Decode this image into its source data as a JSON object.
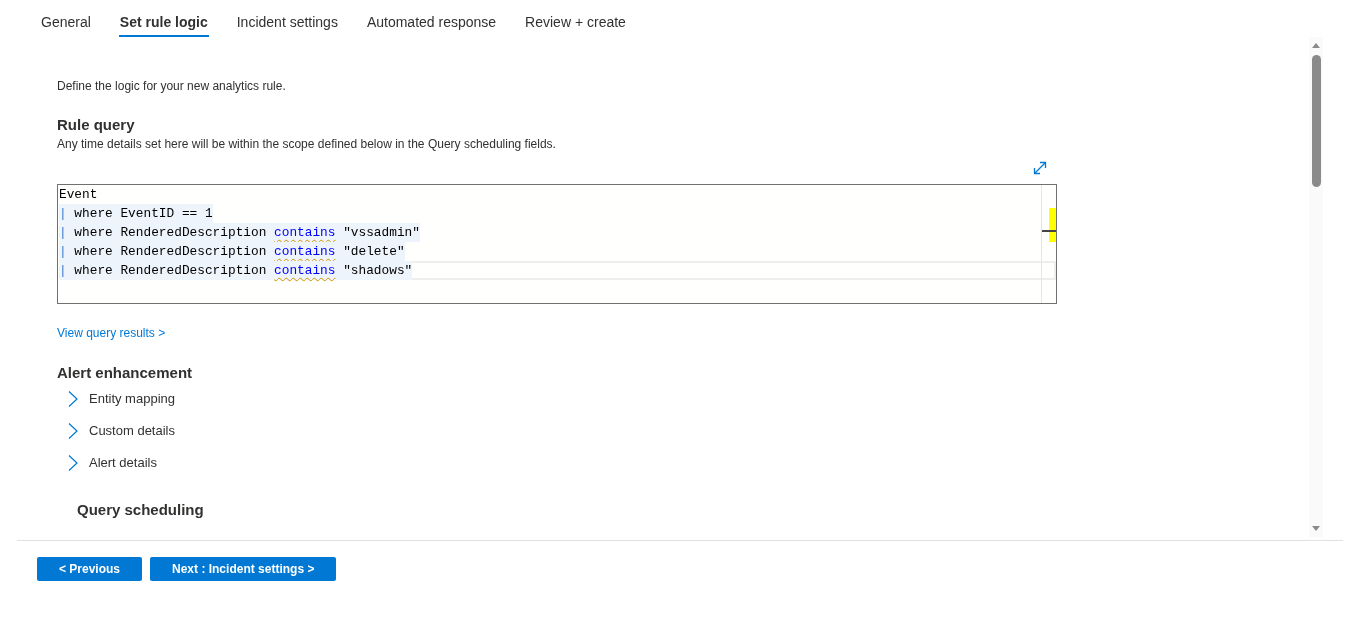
{
  "tabs": [
    {
      "label": "General",
      "selected": false
    },
    {
      "label": "Set rule logic",
      "selected": true
    },
    {
      "label": "Incident settings",
      "selected": false
    },
    {
      "label": "Automated response",
      "selected": false
    },
    {
      "label": "Review + create",
      "selected": false
    }
  ],
  "intro": "Define the logic for your new analytics rule.",
  "rule_query": {
    "title": "Rule query",
    "description": "Any time details set here will be within the scope defined below in the Query scheduling fields.",
    "editor": {
      "lines": [
        {
          "selected": false,
          "current": false,
          "tokens": [
            {
              "kind": "text",
              "text": "Event",
              "warning": false
            }
          ]
        },
        {
          "selected": true,
          "current": false,
          "tokens": [
            {
              "kind": "operator",
              "text": "|",
              "warning": false
            },
            {
              "kind": "text",
              "text": " where EventID == 1",
              "warning": false
            }
          ]
        },
        {
          "selected": true,
          "current": false,
          "tokens": [
            {
              "kind": "operator",
              "text": "|",
              "warning": false
            },
            {
              "kind": "text",
              "text": " where RenderedDescription ",
              "warning": false
            },
            {
              "kind": "keyword",
              "text": "contains",
              "warning": true
            },
            {
              "kind": "text",
              "text": " \"vssadmin\"",
              "warning": false
            }
          ]
        },
        {
          "selected": true,
          "current": false,
          "tokens": [
            {
              "kind": "operator",
              "text": "|",
              "warning": false
            },
            {
              "kind": "text",
              "text": " where RenderedDescription ",
              "warning": false
            },
            {
              "kind": "keyword",
              "text": "contains",
              "warning": true
            },
            {
              "kind": "text",
              "text": " \"delete\"",
              "warning": false
            }
          ]
        },
        {
          "selected": true,
          "current": true,
          "tokens": [
            {
              "kind": "operator",
              "text": "|",
              "warning": false
            },
            {
              "kind": "text",
              "text": " where RenderedDescription ",
              "warning": false
            },
            {
              "kind": "keyword",
              "text": "contains",
              "warning": true
            },
            {
              "kind": "text",
              "text": " \"shadows\"",
              "warning": false
            }
          ]
        }
      ]
    },
    "link": "View query results >"
  },
  "alert_enhancement": {
    "title": "Alert enhancement",
    "sections": [
      {
        "label": "Entity mapping",
        "expanded": false
      },
      {
        "label": "Custom details",
        "expanded": false
      },
      {
        "label": "Alert details",
        "expanded": false
      }
    ]
  },
  "query_scheduling": {
    "title": "Query scheduling"
  },
  "buttons": [
    "< Previous",
    "Next : Incident settings >"
  ]
}
